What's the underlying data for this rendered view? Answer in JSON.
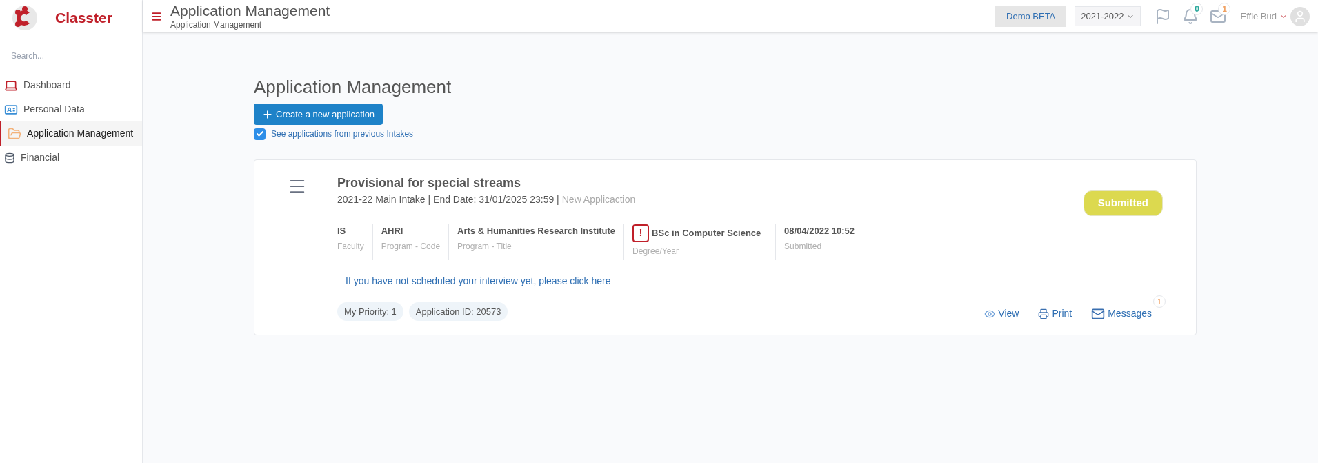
{
  "brand": {
    "name": "Classter"
  },
  "sidebar": {
    "search": {
      "placeholder": "Search..."
    },
    "items": [
      {
        "label": "Dashboard",
        "kind": "laptop",
        "selected": false
      },
      {
        "label": "Personal Data",
        "kind": "card",
        "selected": false
      },
      {
        "label": "Application Management",
        "kind": "folder",
        "selected": true
      },
      {
        "label": "Financial",
        "kind": "coins",
        "selected": false
      }
    ]
  },
  "header": {
    "title": "Application Management",
    "breadcrumb": "Application Management",
    "env_button": "Demo BETA",
    "year_select": "2021-2022",
    "icons": [
      {
        "kind": "flag"
      },
      {
        "kind": "bell",
        "badge": "0",
        "color": "#26a69a"
      },
      {
        "kind": "mail",
        "badge": "1",
        "color": "#f0a060"
      }
    ],
    "user": "Effie Bud"
  },
  "page": {
    "title": "Application Management",
    "create_button": "Create a new application",
    "previous_intakes": {
      "label": "See applications from previous Intakes",
      "checked": true
    }
  },
  "applications": [
    {
      "title": "Provisional for special streams",
      "meta": "2021-22 Main Intake | End Date: 31/01/2025 23:59 |",
      "type_note": "New Applicaction",
      "status": "Submitted",
      "fields": [
        {
          "value": "IS",
          "label": "Faculty",
          "kind": "plain"
        },
        {
          "value": "AHRI",
          "label": "Program - Code",
          "kind": "plain"
        },
        {
          "value": "Arts & Humanities Research Institute",
          "label": "Program - Title",
          "kind": "plain"
        },
        {
          "value": "BSc in Computer Science",
          "label": "Degree/Year",
          "kind": "warning",
          "icon_text": "!"
        },
        {
          "value": "08/04/2022 10:52",
          "label": "Submitted",
          "kind": "plain"
        }
      ],
      "interview_link": "If you have not scheduled your interview yet, please click here",
      "tags": [
        "My Priority: 1",
        "Application ID: 20573"
      ],
      "actions": [
        {
          "label": "View",
          "kind": "eye"
        },
        {
          "label": "Print",
          "kind": "printer"
        },
        {
          "label": "Messages",
          "kind": "mail",
          "badge": "1"
        }
      ]
    }
  ]
}
